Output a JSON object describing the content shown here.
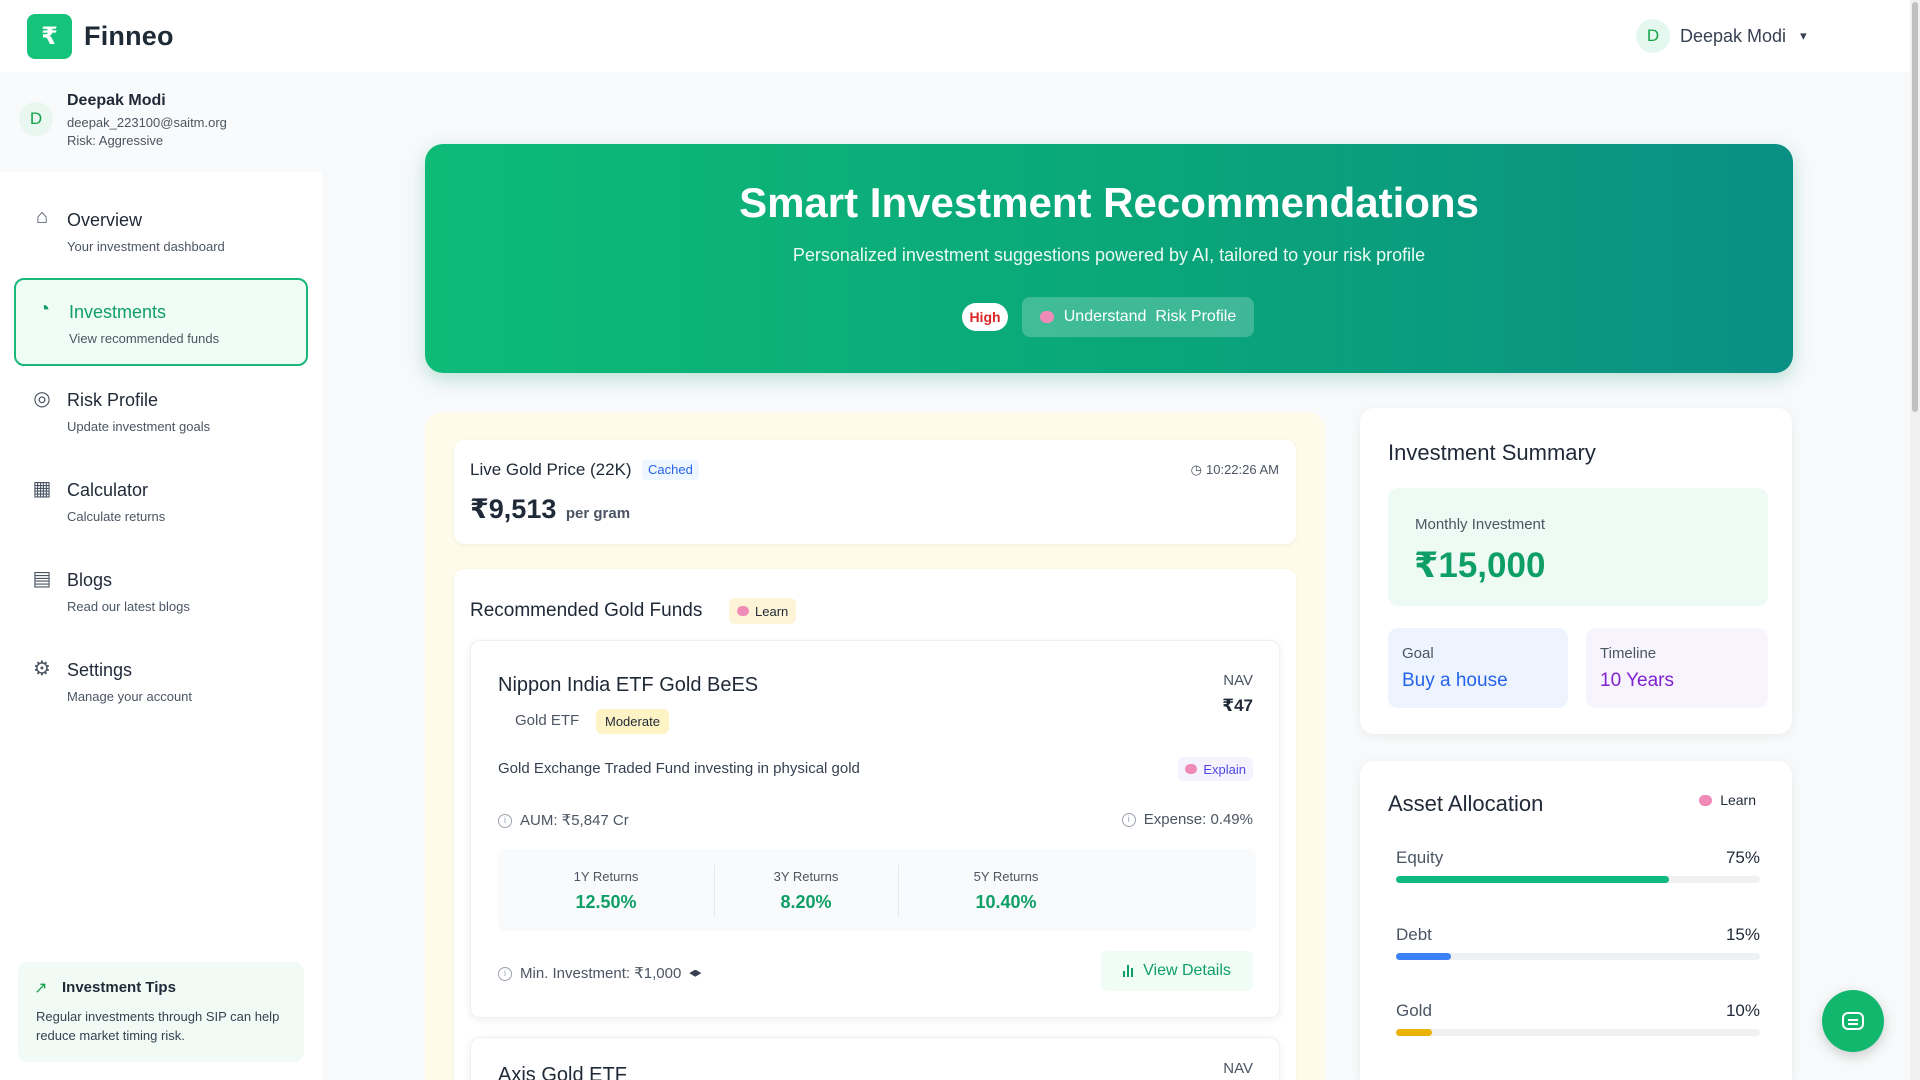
{
  "app": {
    "name": "Finneo",
    "logo_icon": "wallet-logo-icon"
  },
  "topbar": {
    "user_initial": "D",
    "user_name": "Deepak Modi"
  },
  "sidebar": {
    "user": {
      "initial": "D",
      "name": "Deepak Modi",
      "email": "deepak_223100@saitm.org",
      "risk": "Risk: Aggressive"
    },
    "items": [
      {
        "label": "Overview",
        "sub": "Your investment dashboard",
        "icon": "home-icon",
        "glyph": "⌂",
        "active": false
      },
      {
        "label": "Investments",
        "sub": "View recommended funds",
        "icon": "pie-chart-icon",
        "glyph": "◔",
        "active": true
      },
      {
        "label": "Risk Profile",
        "sub": "Update investment goals",
        "icon": "target-icon",
        "glyph": "◎",
        "active": false
      },
      {
        "label": "Calculator",
        "sub": "Calculate returns",
        "icon": "calculator-icon",
        "glyph": "▦",
        "active": false
      },
      {
        "label": "Blogs",
        "sub": "Read our latest blogs",
        "icon": "book-icon",
        "glyph": "▤",
        "active": false
      },
      {
        "label": "Settings",
        "sub": "Manage your account",
        "icon": "gear-icon",
        "glyph": "⚙",
        "active": false
      }
    ],
    "tips": {
      "title": "Investment Tips",
      "text": "Regular investments through SIP can help reduce market timing risk."
    }
  },
  "hero": {
    "title": "Smart Investment Recommendations",
    "subtitle": "Personalized investment suggestions powered by AI, tailored to your risk profile",
    "risk_badge": "High",
    "button_label": "Understand  Risk Profile"
  },
  "gold_price": {
    "title": "Live Gold Price (22K)",
    "cache_badge": "Cached",
    "time": "10:22:26 AM",
    "price": "₹9,513",
    "unit": "per gram"
  },
  "funds": {
    "title": "Recommended Gold Funds",
    "learn_label": "Learn",
    "items": [
      {
        "name": "Nippon India ETF Gold BeES",
        "type": "Gold ETF",
        "risk": "Moderate",
        "nav_label": "NAV",
        "nav_value": "₹47",
        "description": "Gold Exchange Traded Fund investing in physical gold",
        "explain_label": "Explain",
        "aum": "AUM: ₹5,847 Cr",
        "expense": "Expense: 0.49%",
        "returns": [
          {
            "label": "1Y Returns",
            "value": "12.50%"
          },
          {
            "label": "3Y Returns",
            "value": "8.20%"
          },
          {
            "label": "5Y Returns",
            "value": "10.40%"
          }
        ],
        "min_investment": "Min. Investment: ₹1,000",
        "view_label": "View Details"
      },
      {
        "name": "Axis Gold ETF",
        "nav_label": "NAV"
      }
    ]
  },
  "summary": {
    "title": "Investment Summary",
    "monthly_label": "Monthly Investment",
    "monthly_value": "₹15,000",
    "goal_label": "Goal",
    "goal_value": "Buy a house",
    "timeline_label": "Timeline",
    "timeline_value": "10 Years"
  },
  "allocation": {
    "title": "Asset Allocation",
    "learn_label": "Learn",
    "items": [
      {
        "name": "Equity",
        "pct_label": "75%",
        "fraction": 0.75,
        "color": "#10b981"
      },
      {
        "name": "Debt",
        "pct_label": "15%",
        "fraction": 0.15,
        "color": "#3b82f6"
      },
      {
        "name": "Gold",
        "pct_label": "10%",
        "fraction": 0.1,
        "color": "#eab308"
      }
    ]
  },
  "colors": {
    "brand": "#16c37b",
    "accent_text": "#0f9f66"
  }
}
